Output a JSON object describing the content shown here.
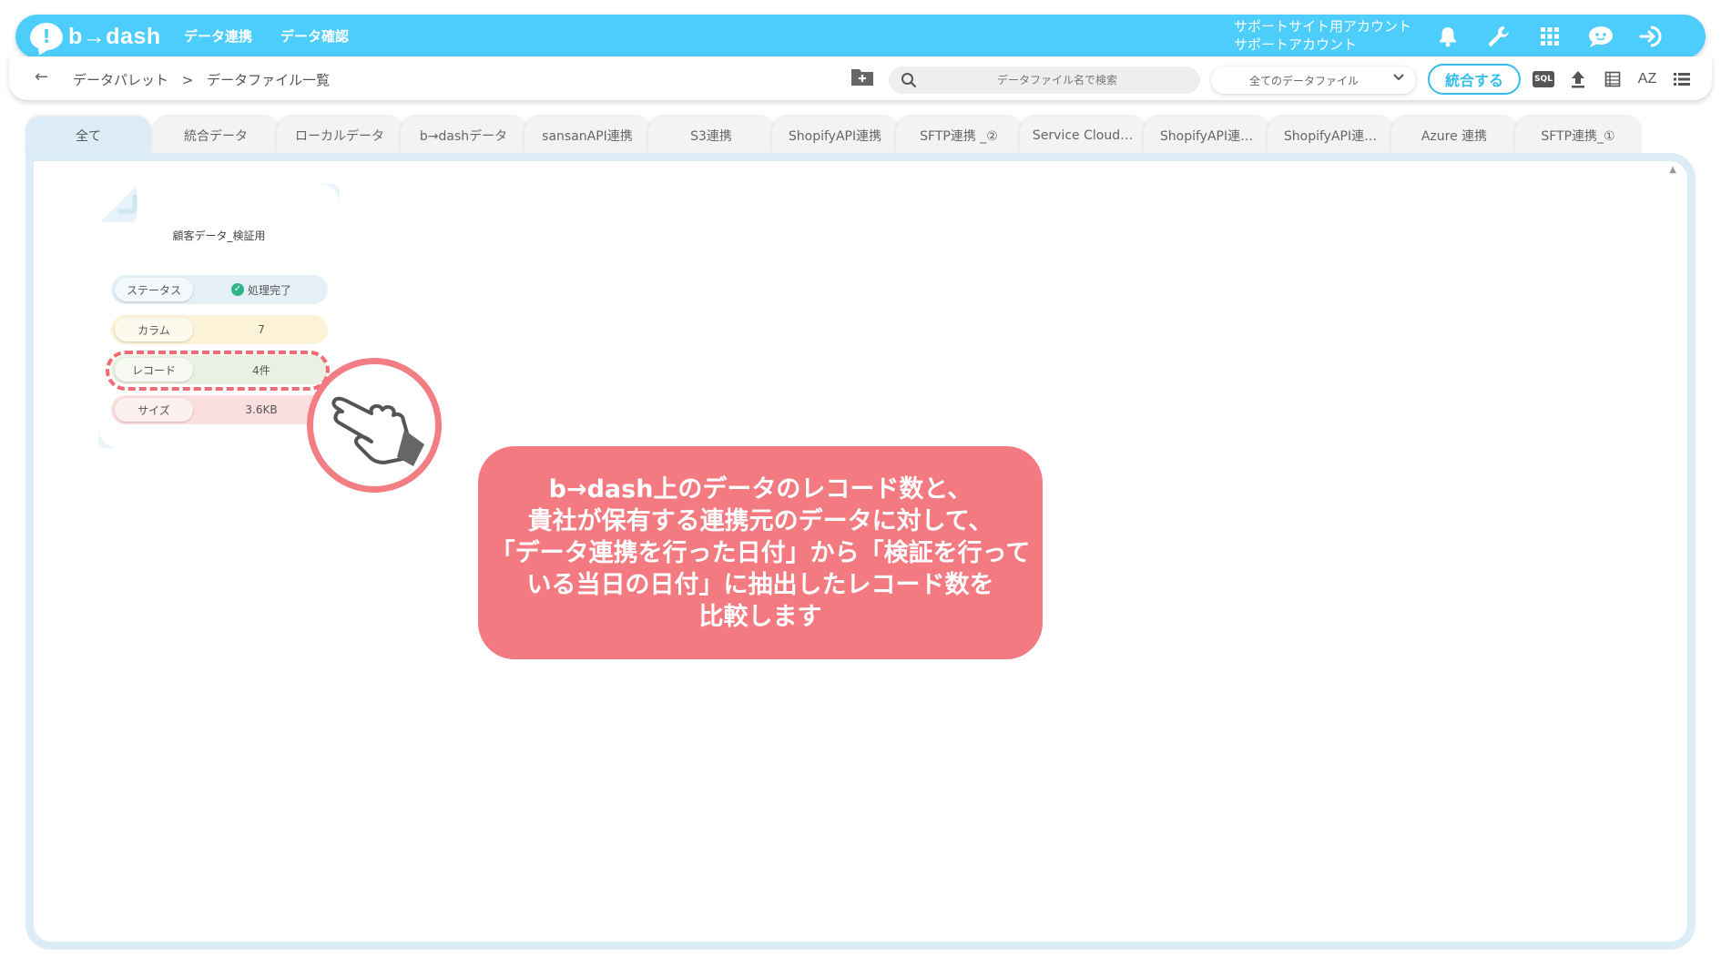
{
  "app": {
    "logo_mark": "!",
    "logo_text": "b→dash"
  },
  "topbar": {
    "nav": [
      "データ連携",
      "データ確認"
    ],
    "account_line1": "サポートサイト用アカウント",
    "account_line2": "サポートアカウント",
    "icons": [
      "bell-icon",
      "wrench-icon",
      "apps-grid-icon",
      "chat-bot-icon",
      "logout-icon"
    ]
  },
  "subbar": {
    "back_icon": "←",
    "breadcrumb": [
      "データパレット",
      ">",
      "データファイル一覧"
    ],
    "search_placeholder": "データファイル名で検索",
    "file_filter": "全てのデータファイル",
    "merge_button": "統合する",
    "sql_label": "SQL",
    "sort_label": "AZ"
  },
  "tabs": [
    {
      "label": "全て",
      "active": true
    },
    {
      "label": "統合データ"
    },
    {
      "label": "ローカルデータ"
    },
    {
      "label": "b→dashデータ"
    },
    {
      "label": "sansanAPI連携"
    },
    {
      "label": "S3連携"
    },
    {
      "label": "ShopifyAPI連携"
    },
    {
      "label": "SFTP連携 _②"
    },
    {
      "label": "Service Cloud…"
    },
    {
      "label": "ShopifyAPI連…"
    },
    {
      "label": "ShopifyAPI連…"
    },
    {
      "label": "Azure 連携"
    },
    {
      "label": "SFTP連携_①"
    }
  ],
  "card": {
    "title": "顧客データ_検証用",
    "status_label": "ステータス",
    "status_value": "処理完了",
    "column_label": "カラム",
    "column_value": "7",
    "record_label": "レコード",
    "record_value": "4件",
    "size_label": "サイズ",
    "size_value": "3.6KB"
  },
  "callout": {
    "text": "b→dash上のデータのレコード数と、\n貴社が保有する連携元のデータに対して、\n「データ連携を行った日付」から「検証を行って\nいる当日の日付」に抽出したレコード数を\n比較します"
  },
  "colors": {
    "brand": "#4ccdfb",
    "accent": "#34bde9",
    "callout": "#f27a80",
    "highlight": "#f06b73",
    "status_ok": "#2fb58a"
  }
}
